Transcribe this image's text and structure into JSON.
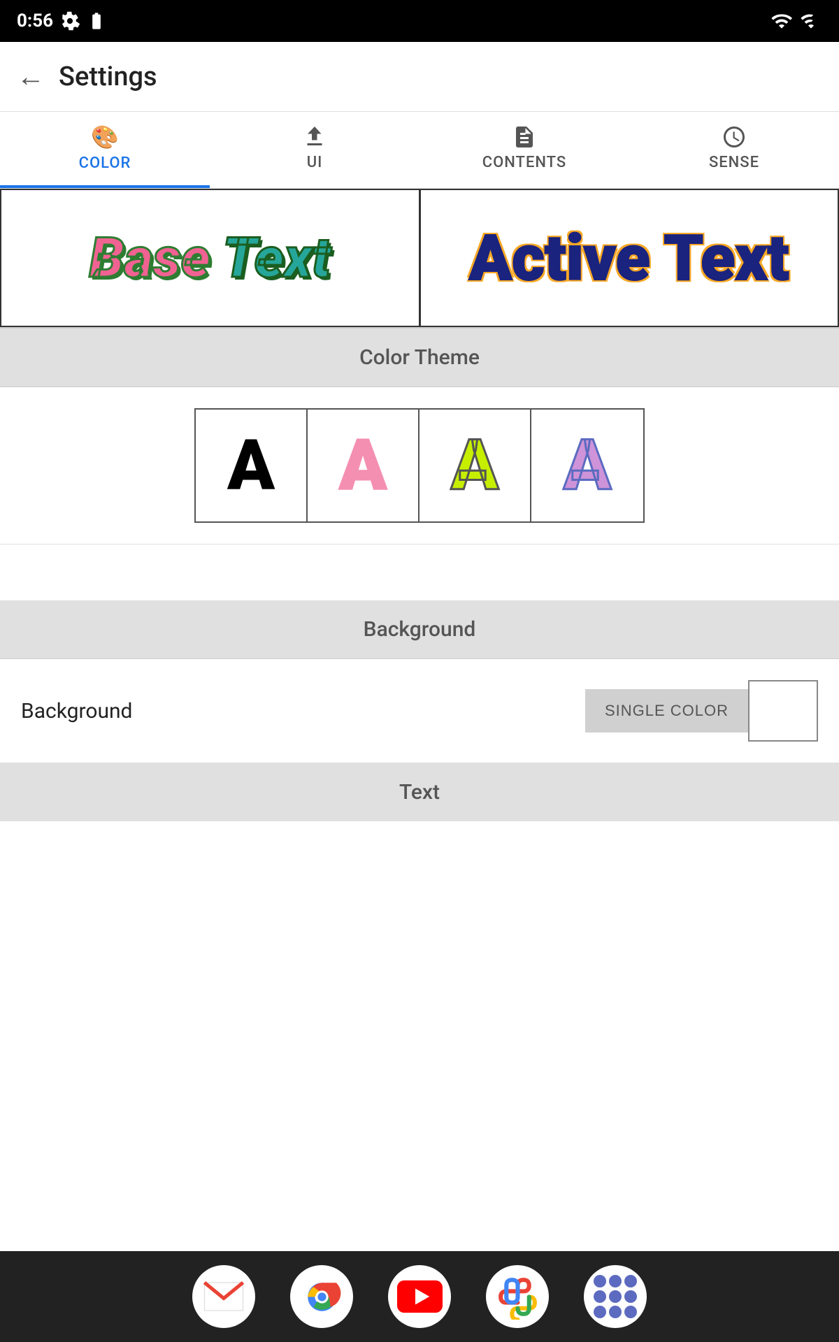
{
  "statusBar": {
    "time": "0:56",
    "wifiIcon": "wifi-icon",
    "signalIcon": "signal-icon"
  },
  "appBar": {
    "backLabel": "←",
    "title": "Settings"
  },
  "tabs": [
    {
      "id": "color",
      "label": "COLOR",
      "icon": "palette",
      "active": true
    },
    {
      "id": "ui",
      "label": "UI",
      "icon": "download",
      "active": false
    },
    {
      "id": "contents",
      "label": "CONTENTS",
      "icon": "document",
      "active": false
    },
    {
      "id": "sense",
      "label": "SENSE",
      "icon": "clock",
      "active": false
    }
  ],
  "preview": {
    "baseTextLeft": "Base",
    "baseTextRight": "Text",
    "activeText": "Active Text"
  },
  "colorTheme": {
    "sectionLabel": "Color Theme",
    "options": [
      {
        "letter": "A",
        "style": "black"
      },
      {
        "letter": "A",
        "style": "pink"
      },
      {
        "letter": "A",
        "style": "green"
      },
      {
        "letter": "A",
        "style": "purple"
      }
    ]
  },
  "background": {
    "sectionLabel": "Background",
    "rowLabel": "Background",
    "singleColorLabel": "SINGLE COLOR"
  },
  "text": {
    "sectionLabel": "Text"
  },
  "bottomNav": {
    "apps": [
      "gmail",
      "chrome",
      "youtube",
      "photos",
      "apps"
    ]
  }
}
